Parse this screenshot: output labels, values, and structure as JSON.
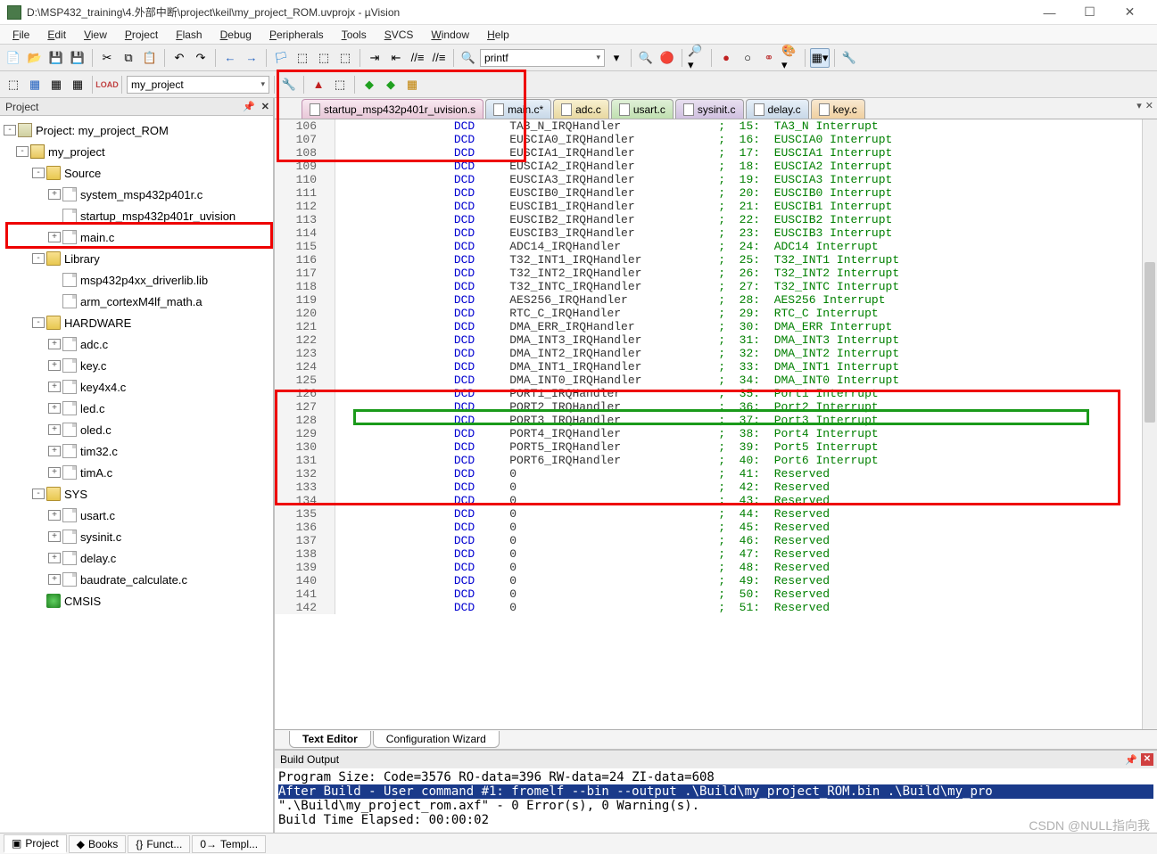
{
  "window": {
    "title": "D:\\MSP432_training\\4.外部中断\\project\\keil\\my_project_ROM.uvprojx - µVision",
    "min": "—",
    "max": "☐",
    "close": "✕"
  },
  "menu": [
    "File",
    "Edit",
    "View",
    "Project",
    "Flash",
    "Debug",
    "Peripherals",
    "Tools",
    "SVCS",
    "Window",
    "Help"
  ],
  "toolbar1_combo": "printf",
  "toolbar2_combo": "my_project",
  "project_panel": {
    "title": "Project"
  },
  "tree": [
    {
      "lvl": 0,
      "exp": "-",
      "ico": "proj",
      "label": "Project: my_project_ROM"
    },
    {
      "lvl": 1,
      "exp": "-",
      "ico": "target",
      "label": "my_project"
    },
    {
      "lvl": 2,
      "exp": "-",
      "ico": "folder",
      "label": "Source"
    },
    {
      "lvl": 3,
      "exp": "+",
      "ico": "file",
      "label": "system_msp432p401r.c"
    },
    {
      "lvl": 3,
      "exp": "",
      "ico": "file",
      "label": "startup_msp432p401r_uvision"
    },
    {
      "lvl": 3,
      "exp": "+",
      "ico": "file",
      "label": "main.c"
    },
    {
      "lvl": 2,
      "exp": "-",
      "ico": "folder",
      "label": "Library"
    },
    {
      "lvl": 3,
      "exp": "",
      "ico": "file",
      "label": "msp432p4xx_driverlib.lib"
    },
    {
      "lvl": 3,
      "exp": "",
      "ico": "file",
      "label": "arm_cortexM4lf_math.a"
    },
    {
      "lvl": 2,
      "exp": "-",
      "ico": "folder",
      "label": "HARDWARE"
    },
    {
      "lvl": 3,
      "exp": "+",
      "ico": "file",
      "label": "adc.c"
    },
    {
      "lvl": 3,
      "exp": "+",
      "ico": "file",
      "label": "key.c"
    },
    {
      "lvl": 3,
      "exp": "+",
      "ico": "file",
      "label": "key4x4.c"
    },
    {
      "lvl": 3,
      "exp": "+",
      "ico": "file",
      "label": "led.c"
    },
    {
      "lvl": 3,
      "exp": "+",
      "ico": "file",
      "label": "oled.c"
    },
    {
      "lvl": 3,
      "exp": "+",
      "ico": "file",
      "label": "tim32.c"
    },
    {
      "lvl": 3,
      "exp": "+",
      "ico": "file",
      "label": "timA.c"
    },
    {
      "lvl": 2,
      "exp": "-",
      "ico": "folder",
      "label": "SYS"
    },
    {
      "lvl": 3,
      "exp": "+",
      "ico": "file",
      "label": "usart.c"
    },
    {
      "lvl": 3,
      "exp": "+",
      "ico": "file",
      "label": "sysinit.c"
    },
    {
      "lvl": 3,
      "exp": "+",
      "ico": "file",
      "label": "delay.c"
    },
    {
      "lvl": 3,
      "exp": "+",
      "ico": "file",
      "label": "baudrate_calculate.c"
    },
    {
      "lvl": 2,
      "exp": "",
      "ico": "green",
      "label": "CMSIS"
    }
  ],
  "tabs": [
    {
      "label": "startup_msp432p401r_uvision.s",
      "cls": "tab-active"
    },
    {
      "label": "main.c*",
      "cls": "tab-blue"
    },
    {
      "label": "adc.c",
      "cls": "tab-yellow"
    },
    {
      "label": "usart.c",
      "cls": "tab-green"
    },
    {
      "label": "sysinit.c",
      "cls": "tab-purple"
    },
    {
      "label": "delay.c",
      "cls": "tab-blue"
    },
    {
      "label": "key.c",
      "cls": "tab-orange"
    }
  ],
  "code": [
    {
      "n": 106,
      "op": "DCD",
      "h": "TA3_N_IRQHandler",
      "i": 15,
      "c": "TA3_N Interrupt"
    },
    {
      "n": 107,
      "op": "DCD",
      "h": "EUSCIA0_IRQHandler",
      "i": 16,
      "c": "EUSCIA0 Interrupt"
    },
    {
      "n": 108,
      "op": "DCD",
      "h": "EUSCIA1_IRQHandler",
      "i": 17,
      "c": "EUSCIA1 Interrupt"
    },
    {
      "n": 109,
      "op": "DCD",
      "h": "EUSCIA2_IRQHandler",
      "i": 18,
      "c": "EUSCIA2 Interrupt"
    },
    {
      "n": 110,
      "op": "DCD",
      "h": "EUSCIA3_IRQHandler",
      "i": 19,
      "c": "EUSCIA3 Interrupt"
    },
    {
      "n": 111,
      "op": "DCD",
      "h": "EUSCIB0_IRQHandler",
      "i": 20,
      "c": "EUSCIB0 Interrupt"
    },
    {
      "n": 112,
      "op": "DCD",
      "h": "EUSCIB1_IRQHandler",
      "i": 21,
      "c": "EUSCIB1 Interrupt"
    },
    {
      "n": 113,
      "op": "DCD",
      "h": "EUSCIB2_IRQHandler",
      "i": 22,
      "c": "EUSCIB2 Interrupt"
    },
    {
      "n": 114,
      "op": "DCD",
      "h": "EUSCIB3_IRQHandler",
      "i": 23,
      "c": "EUSCIB3 Interrupt"
    },
    {
      "n": 115,
      "op": "DCD",
      "h": "ADC14_IRQHandler",
      "i": 24,
      "c": "ADC14 Interrupt"
    },
    {
      "n": 116,
      "op": "DCD",
      "h": "T32_INT1_IRQHandler",
      "i": 25,
      "c": "T32_INT1 Interrupt"
    },
    {
      "n": 117,
      "op": "DCD",
      "h": "T32_INT2_IRQHandler",
      "i": 26,
      "c": "T32_INT2 Interrupt"
    },
    {
      "n": 118,
      "op": "DCD",
      "h": "T32_INTC_IRQHandler",
      "i": 27,
      "c": "T32_INTC Interrupt"
    },
    {
      "n": 119,
      "op": "DCD",
      "h": "AES256_IRQHandler",
      "i": 28,
      "c": "AES256 Interrupt"
    },
    {
      "n": 120,
      "op": "DCD",
      "h": "RTC_C_IRQHandler",
      "i": 29,
      "c": "RTC_C Interrupt"
    },
    {
      "n": 121,
      "op": "DCD",
      "h": "DMA_ERR_IRQHandler",
      "i": 30,
      "c": "DMA_ERR Interrupt"
    },
    {
      "n": 122,
      "op": "DCD",
      "h": "DMA_INT3_IRQHandler",
      "i": 31,
      "c": "DMA_INT3 Interrupt"
    },
    {
      "n": 123,
      "op": "DCD",
      "h": "DMA_INT2_IRQHandler",
      "i": 32,
      "c": "DMA_INT2 Interrupt"
    },
    {
      "n": 124,
      "op": "DCD",
      "h": "DMA_INT1_IRQHandler",
      "i": 33,
      "c": "DMA_INT1 Interrupt"
    },
    {
      "n": 125,
      "op": "DCD",
      "h": "DMA_INT0_IRQHandler",
      "i": 34,
      "c": "DMA_INT0 Interrupt"
    },
    {
      "n": 126,
      "op": "DCD",
      "h": "PORT1_IRQHandler",
      "i": 35,
      "c": "Port1 Interrupt"
    },
    {
      "n": 127,
      "op": "DCD",
      "h": "PORT2_IRQHandler",
      "i": 36,
      "c": "Port2 Interrupt"
    },
    {
      "n": 128,
      "op": "DCD",
      "h": "PORT3_IRQHandler",
      "i": 37,
      "c": "Port3 Interrupt"
    },
    {
      "n": 129,
      "op": "DCD",
      "h": "PORT4_IRQHandler",
      "i": 38,
      "c": "Port4 Interrupt"
    },
    {
      "n": 130,
      "op": "DCD",
      "h": "PORT5_IRQHandler",
      "i": 39,
      "c": "Port5 Interrupt"
    },
    {
      "n": 131,
      "op": "DCD",
      "h": "PORT6_IRQHandler",
      "i": 40,
      "c": "Port6 Interrupt"
    },
    {
      "n": 132,
      "op": "DCD",
      "h": "0",
      "i": 41,
      "c": "Reserved"
    },
    {
      "n": 133,
      "op": "DCD",
      "h": "0",
      "i": 42,
      "c": "Reserved"
    },
    {
      "n": 134,
      "op": "DCD",
      "h": "0",
      "i": 43,
      "c": "Reserved"
    },
    {
      "n": 135,
      "op": "DCD",
      "h": "0",
      "i": 44,
      "c": "Reserved"
    },
    {
      "n": 136,
      "op": "DCD",
      "h": "0",
      "i": 45,
      "c": "Reserved"
    },
    {
      "n": 137,
      "op": "DCD",
      "h": "0",
      "i": 46,
      "c": "Reserved"
    },
    {
      "n": 138,
      "op": "DCD",
      "h": "0",
      "i": 47,
      "c": "Reserved"
    },
    {
      "n": 139,
      "op": "DCD",
      "h": "0",
      "i": 48,
      "c": "Reserved"
    },
    {
      "n": 140,
      "op": "DCD",
      "h": "0",
      "i": 49,
      "c": "Reserved"
    },
    {
      "n": 141,
      "op": "DCD",
      "h": "0",
      "i": 50,
      "c": "Reserved"
    },
    {
      "n": 142,
      "op": "DCD",
      "h": "0",
      "i": 51,
      "c": "Reserved"
    }
  ],
  "bottom_tabs": {
    "text_editor": "Text Editor",
    "config_wizard": "Configuration Wizard"
  },
  "build": {
    "title": "Build Output",
    "lines": [
      "Program Size: Code=3576 RO-data=396 RW-data=24 ZI-data=608",
      "After Build - User command #1: fromelf --bin --output .\\Build\\my_project_ROM.bin .\\Build\\my_pro",
      "\".\\Build\\my_project_rom.axf\" - 0 Error(s), 0 Warning(s).",
      "Build Time Elapsed:  00:00:02"
    ]
  },
  "status_tabs": [
    {
      "ico": "▣",
      "label": "Project"
    },
    {
      "ico": "◆",
      "label": "Books"
    },
    {
      "ico": "{}",
      "label": "Funct..."
    },
    {
      "ico": "0→",
      "label": "Templ..."
    }
  ],
  "watermark": "CSDN @NULL指向我"
}
